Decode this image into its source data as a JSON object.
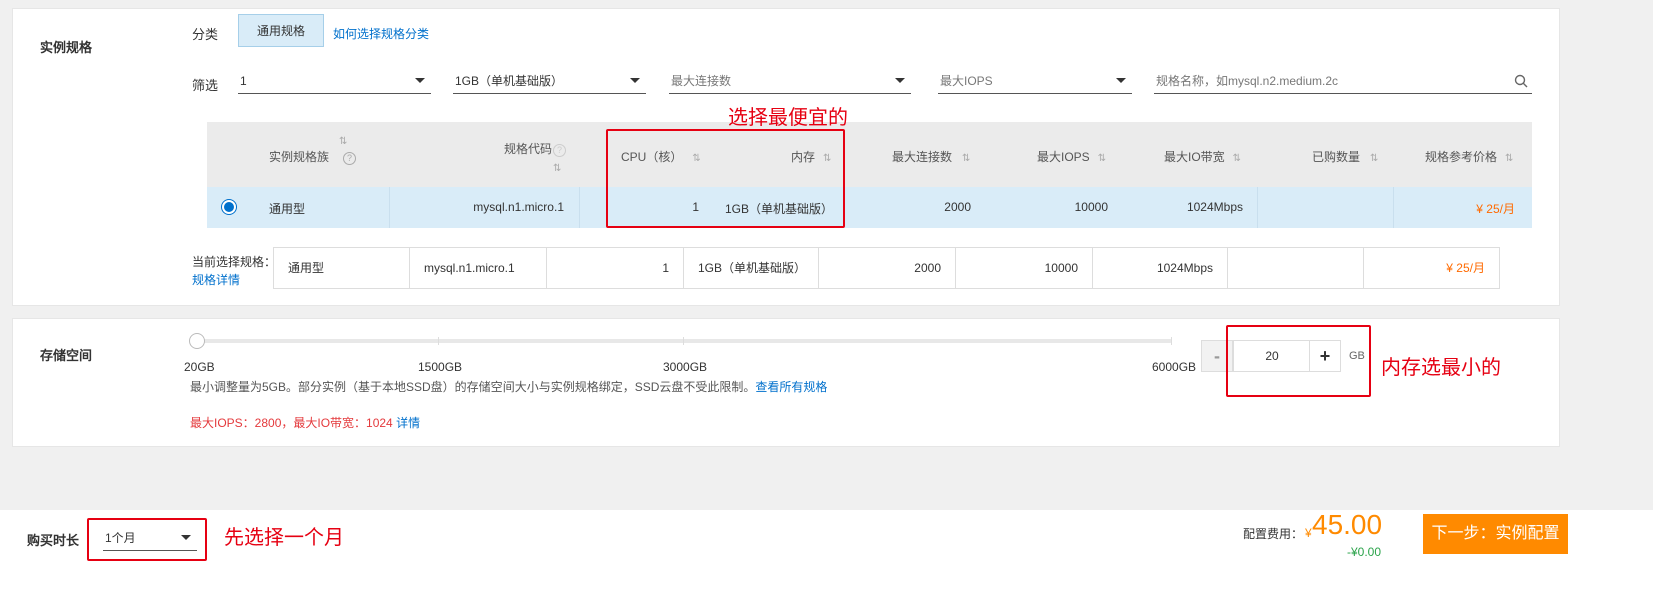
{
  "spec_section": {
    "title": "实例规格",
    "category_label": "分类",
    "category_tab": "通用规格",
    "category_help_link": "如何选择规格分类",
    "filter_label": "筛选",
    "filters": {
      "cpu_value": "1",
      "memory_value": "1GB（单机基础版）",
      "max_connections_placeholder": "最大连接数",
      "max_iops_placeholder": "最大IOPS",
      "search_placeholder": "规格名称，如mysql.n2.medium.2c"
    },
    "table": {
      "headers": [
        "实例规格族",
        "规格代码",
        "CPU（核）",
        "内存",
        "最大连接数",
        "最大IOPS",
        "最大IO带宽",
        "已购数量",
        "规格参考价格"
      ],
      "selected_row": {
        "family": "通用型",
        "code": "mysql.n1.micro.1",
        "cpu": "1",
        "memory": "1GB（单机基础版）",
        "max_connections": "2000",
        "max_iops": "10000",
        "max_io_bandwidth": "1024Mbps",
        "purchased": "",
        "price": "¥ 25/月"
      }
    },
    "current_selection_label": "当前选择规格：",
    "spec_details_link": "规格详情",
    "current_selection": {
      "family": "通用型",
      "code": "mysql.n1.micro.1",
      "cpu": "1",
      "memory": "1GB（单机基础版）",
      "max_connections": "2000",
      "max_iops": "10000",
      "max_io_bandwidth": "1024Mbps",
      "purchased": "",
      "price": "¥ 25/月"
    }
  },
  "storage_section": {
    "title": "存储空间",
    "slider": {
      "ticks": [
        "20GB",
        "1500GB",
        "3000GB",
        "6000GB"
      ],
      "current_value": 20,
      "min": 20,
      "max": 6000
    },
    "stepper": {
      "minus": "-",
      "value": "20",
      "plus": "+",
      "unit": "GB"
    },
    "hint": "最小调整量为5GB。部分实例（基于本地SSD盘）的存储空间大小与实例规格绑定，SSD云盘不受此限制。",
    "hint_link": "查看所有规格",
    "iops_info": "最大IOPS：2800，最大IO带宽：1024",
    "iops_info_link": "详情"
  },
  "footer": {
    "duration_label": "购买时长",
    "duration_value": "1个月",
    "fee_label": "配置费用：",
    "fee_symbol": "¥",
    "fee_amount": "45.00",
    "fee_discount": "-¥0.00",
    "next_button": "下一步：实例配置"
  },
  "annotations": {
    "cheapest": "选择最便宜的",
    "smallest": "内存选最小的",
    "one_month": "先选择一个月"
  },
  "colors": {
    "accent_orange": "#ff8a00",
    "link_blue": "#0070cc",
    "annotation_red": "#e60012",
    "selected_row_bg": "#d9ecf8"
  }
}
